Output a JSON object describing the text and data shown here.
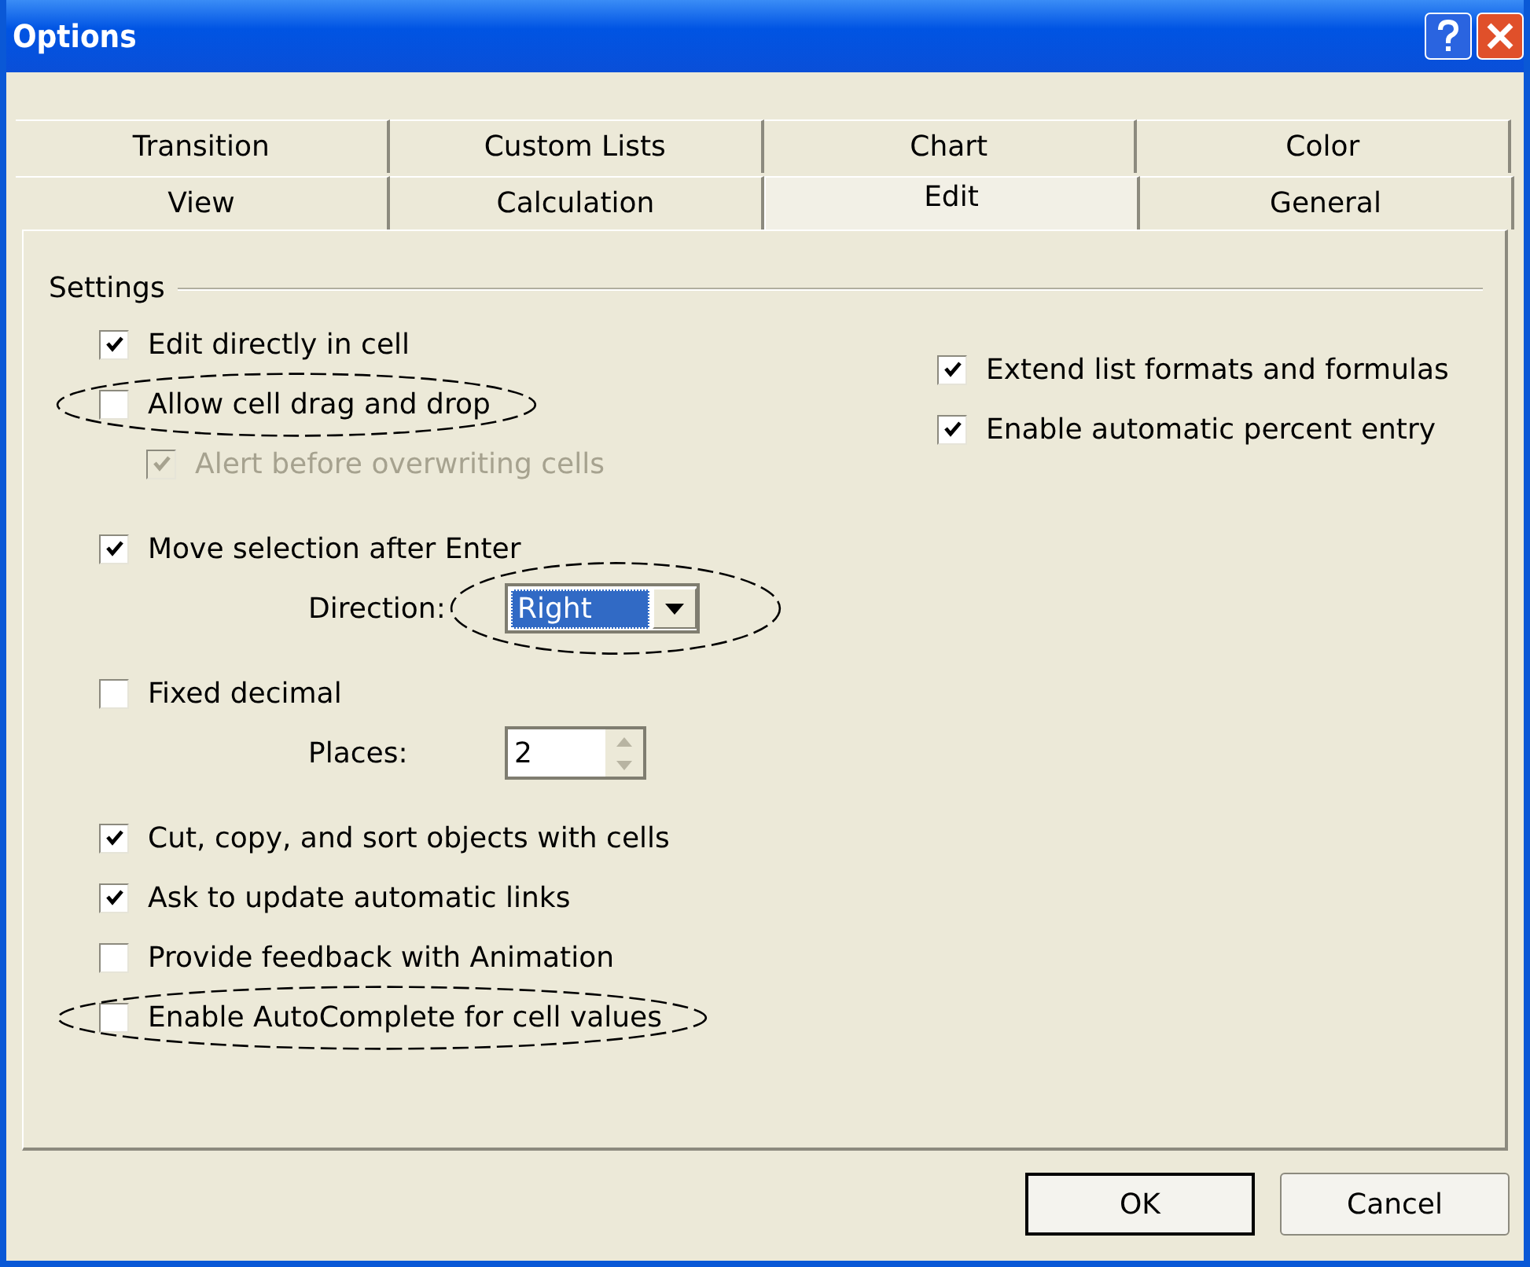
{
  "window": {
    "title": "Options"
  },
  "tab_rows": [
    {
      "tabs": [
        {
          "label": "Transition",
          "selected": false
        },
        {
          "label": "Custom Lists",
          "selected": false
        },
        {
          "label": "Chart",
          "selected": false
        },
        {
          "label": "Color",
          "selected": false
        }
      ]
    },
    {
      "tabs": [
        {
          "label": "View",
          "selected": false
        },
        {
          "label": "Calculation",
          "selected": false
        },
        {
          "label": "Edit",
          "selected": true
        },
        {
          "label": "General",
          "selected": false
        }
      ]
    }
  ],
  "settings": {
    "title": "Settings",
    "columns": [
      {
        "groups": [
          {
            "items": [
              {
                "kind": "checkbox",
                "label": "Edit directly in cell",
                "checked": true,
                "disabled": false,
                "circled": false
              },
              {
                "kind": "checkbox",
                "label": "Allow cell drag and drop",
                "checked": false,
                "disabled": false,
                "circled": true,
                "children": [
                  {
                    "kind": "checkbox",
                    "label": "Alert before overwriting cells",
                    "checked": true,
                    "disabled": true,
                    "circled": false
                  }
                ]
              }
            ]
          },
          {
            "items": [
              {
                "kind": "checkbox",
                "label": "Move selection after Enter",
                "checked": true,
                "disabled": false,
                "circled": false,
                "children": [
                  {
                    "kind": "dropdown",
                    "label": "Direction:",
                    "value": "Right",
                    "circled": true
                  }
                ]
              }
            ]
          },
          {
            "items": [
              {
                "kind": "checkbox",
                "label": "Fixed decimal",
                "checked": false,
                "disabled": false,
                "circled": false,
                "children": [
                  {
                    "kind": "spinner",
                    "label": "Places:",
                    "value": "2",
                    "circled": false
                  }
                ]
              }
            ]
          },
          {
            "items": [
              {
                "kind": "checkbox",
                "label": "Cut, copy, and sort objects with cells",
                "checked": true,
                "disabled": false,
                "circled": false
              },
              {
                "kind": "checkbox",
                "label": "Ask to update automatic links",
                "checked": true,
                "disabled": false,
                "circled": false
              },
              {
                "kind": "checkbox",
                "label": "Provide feedback with Animation",
                "checked": false,
                "disabled": false,
                "circled": false
              },
              {
                "kind": "checkbox",
                "label": "Enable AutoComplete for cell values",
                "checked": false,
                "disabled": false,
                "circled": true
              }
            ]
          }
        ]
      },
      {
        "groups": [
          {
            "items": [
              {
                "kind": "checkbox",
                "label": "Extend list formats and formulas",
                "checked": true,
                "disabled": false,
                "circled": false
              },
              {
                "kind": "checkbox",
                "label": "Enable automatic percent entry",
                "checked": true,
                "disabled": false,
                "circled": false
              }
            ]
          }
        ]
      }
    ]
  },
  "buttons": [
    {
      "label": "OK",
      "default": true
    },
    {
      "label": "Cancel",
      "default": false
    }
  ]
}
